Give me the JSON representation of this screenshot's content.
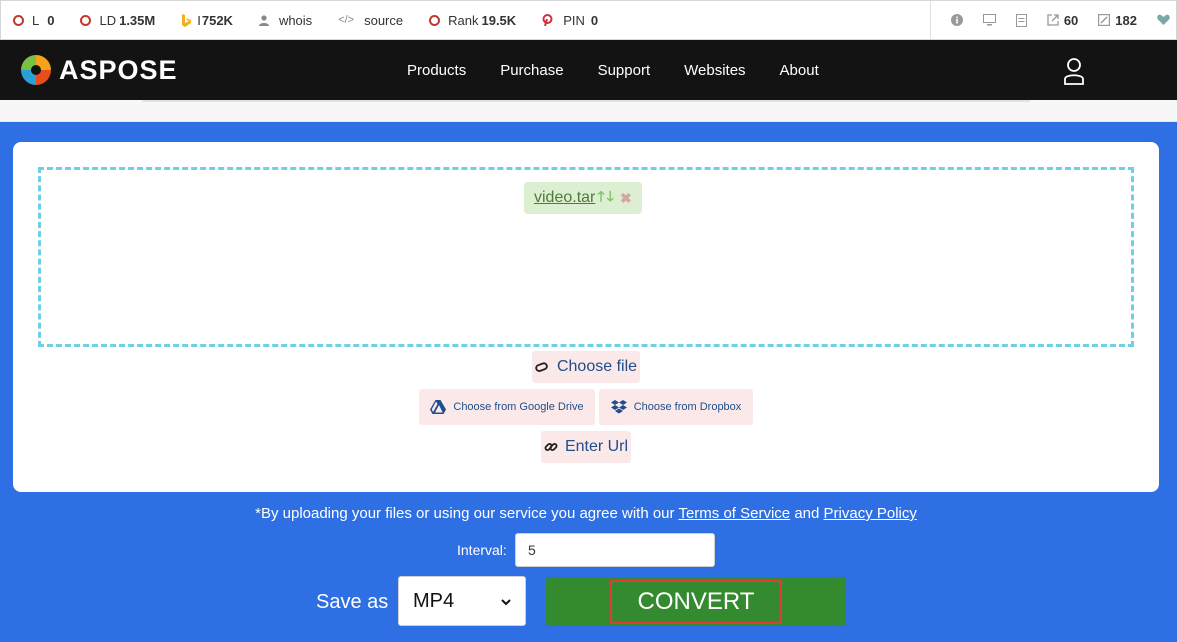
{
  "seo_toolbar": {
    "items": [
      {
        "label": "L",
        "value": "0",
        "icon": "ring-icon"
      },
      {
        "label": "LD",
        "value": "1.35M",
        "icon": "ring-icon"
      },
      {
        "label": "I",
        "value": "752K",
        "icon": "bing-icon"
      },
      {
        "label": "whois",
        "value": "",
        "icon": "user-icon"
      },
      {
        "label": "source",
        "value": "",
        "icon": "code-icon"
      },
      {
        "label": "Rank",
        "value": "19.5K",
        "icon": "ring-icon"
      },
      {
        "label": "PIN",
        "value": "0",
        "icon": "pinterest-icon"
      }
    ],
    "right": {
      "links_out": "60",
      "links_edit": "182"
    }
  },
  "header": {
    "logo_text": "ASPOSE",
    "nav": [
      "Products",
      "Purchase",
      "Support",
      "Websites",
      "About"
    ]
  },
  "upload": {
    "file_name": "video.tar",
    "choose_file": "Choose file",
    "google_drive": "Choose from Google Drive",
    "dropbox": "Choose from Dropbox",
    "enter_url": "Enter Url"
  },
  "terms": {
    "prefix": "*By uploading your files or using our service you agree with our",
    "tos": "Terms of Service",
    "and": "and",
    "privacy": "Privacy Policy"
  },
  "options": {
    "interval_label": "Interval:",
    "interval_value": "5",
    "save_as_label": "Save as",
    "format_value": "MP4",
    "convert_label": "CONVERT"
  },
  "colors": {
    "main_blue": "#2e6fe3",
    "convert_green": "#348a2e",
    "header_black": "#131313"
  }
}
